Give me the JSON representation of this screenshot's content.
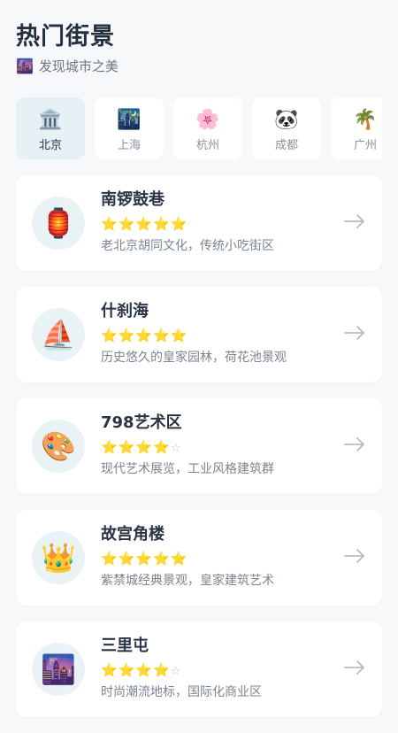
{
  "header": {
    "title": "热门街景",
    "subtitle_icon": "🌆",
    "subtitle": "发现城市之美"
  },
  "cities": [
    {
      "emoji": "🏛️",
      "label": "北京",
      "active": true
    },
    {
      "emoji": "🌃",
      "label": "上海",
      "active": false
    },
    {
      "emoji": "🌸",
      "label": "杭州",
      "active": false
    },
    {
      "emoji": "🐼",
      "label": "成都",
      "active": false
    },
    {
      "emoji": "🌴",
      "label": "广州",
      "active": false
    }
  ],
  "places": [
    {
      "icon": "🏮",
      "name": "南锣鼓巷",
      "rating": 5,
      "desc": "老北京胡同文化，传统小吃街区"
    },
    {
      "icon": "⛵",
      "name": "什刹海",
      "rating": 5,
      "desc": "历史悠久的皇家园林，荷花池景观"
    },
    {
      "icon": "🎨",
      "name": "798艺术区",
      "rating": 4,
      "desc": "现代艺术展览，工业风格建筑群"
    },
    {
      "icon": "👑",
      "name": "故宫角楼",
      "rating": 5,
      "desc": "紫禁城经典景观，皇家建筑艺术"
    },
    {
      "icon": "🌆",
      "name": "三里屯",
      "rating": 4,
      "desc": "时尚潮流地标，国际化商业区"
    }
  ],
  "colors": {
    "accent": "#e6f1f6",
    "star": "#f2b630",
    "background": "#f7f8fa"
  }
}
